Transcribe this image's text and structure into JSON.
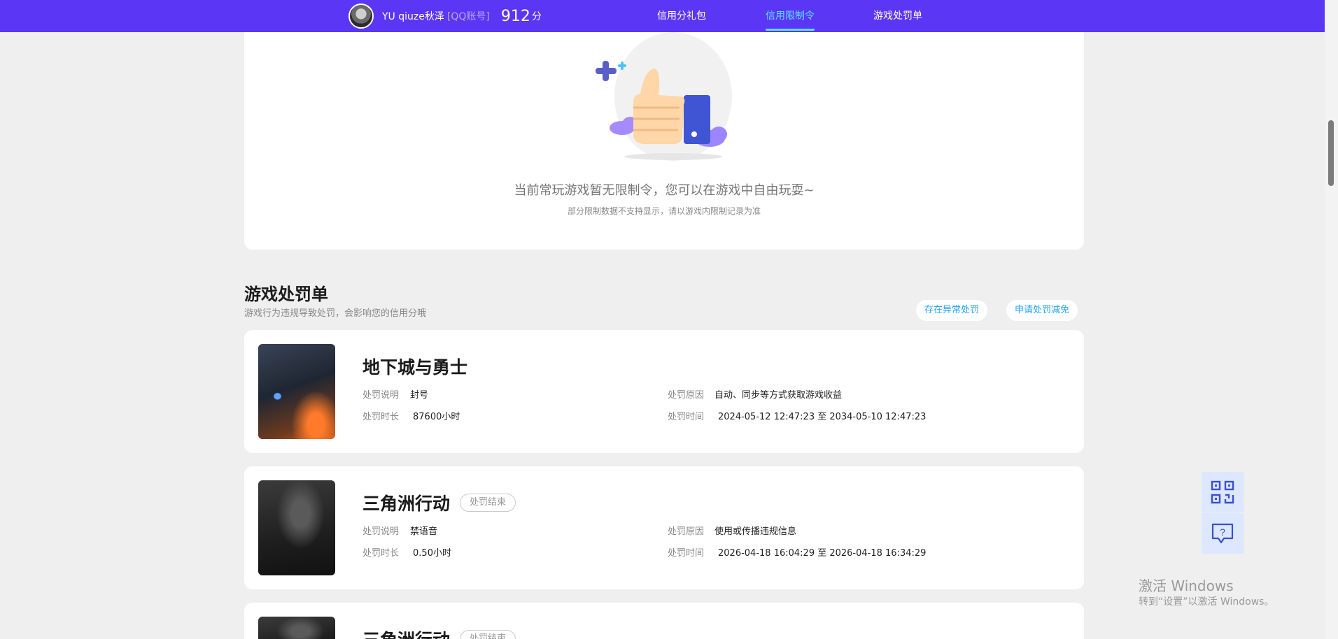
{
  "header": {
    "username": "YU qiuze秋泽",
    "account_type": "[QQ账号]",
    "score": "912",
    "score_unit": "分",
    "nav": [
      "信用分礼包",
      "信用限制令",
      "游戏处罚单"
    ],
    "active_nav": "信用限制令"
  },
  "restriction": {
    "empty_title": "当前常玩游戏暂无限制令，您可以在游戏中自由玩耍~",
    "empty_subtitle": "部分限制数据不支持显示，请以游戏内限制记录为准",
    "illustration": "thumbs-up-icon"
  },
  "penalties": {
    "title": "游戏处罚单",
    "subtitle": "游戏行为违规导致处罚，会影响您的信用分哦",
    "appeal_abnormal": "存在异常处罚",
    "apply_reduction": "申请处罚减免",
    "labels": {
      "desc": "处罚说明",
      "reason": "处罚原因",
      "duration": "处罚时长",
      "time": "处罚时间"
    },
    "items": [
      {
        "game": "地下城与勇士",
        "status": "",
        "desc": "封号",
        "reason": "自动、同步等方式获取游戏收益",
        "duration": "87600小时",
        "time": "2024-05-12 12:47:23 至 2034-05-10 12:47:23"
      },
      {
        "game": "三角洲行动",
        "status": "处罚结束",
        "desc": "禁语音",
        "reason": "使用或传播违规信息",
        "duration": "0.50小时",
        "time": "2026-04-18 16:04:29 至 2026-04-18 16:34:29"
      },
      {
        "game": "三角洲行动",
        "status": "处罚结束"
      }
    ]
  },
  "side_tools": [
    "qr-code-icon",
    "feedback-icon"
  ],
  "watermark": {
    "line1": "激活 Windows",
    "line2": "转到“设置”以激活 Windows。"
  },
  "colors": {
    "nav_bg": "#5b36f5",
    "nav_active": "#5fe0ff",
    "link": "#27a3ff",
    "page_bg": "#efefef"
  }
}
